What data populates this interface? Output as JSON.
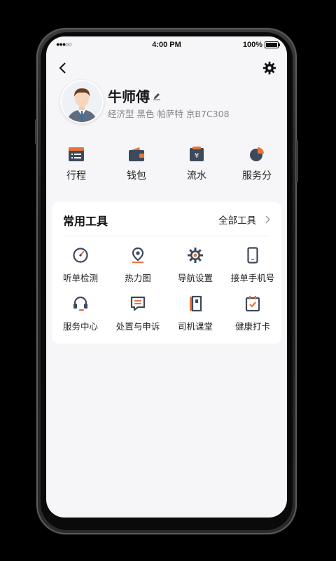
{
  "status_bar": {
    "signal": "●●●○○",
    "time": "4:00 PM",
    "battery": "100%"
  },
  "header": {
    "back_icon": "chevron-left-icon",
    "settings_icon": "gear-icon"
  },
  "profile": {
    "name": "牛师傅",
    "car_info": "经济型 黑色 帕萨特 京B7C308"
  },
  "quick_actions": [
    {
      "label": "行程",
      "icon": "trip-list-icon"
    },
    {
      "label": "钱包",
      "icon": "wallet-icon"
    },
    {
      "label": "流水",
      "icon": "income-flow-icon"
    },
    {
      "label": "服务分",
      "icon": "pie-score-icon"
    }
  ],
  "tools": {
    "title": "常用工具",
    "all_label": "全部工具",
    "items": [
      {
        "label": "听单检测",
        "icon": "gauge-icon"
      },
      {
        "label": "热力图",
        "icon": "location-pin-icon"
      },
      {
        "label": "导航设置",
        "icon": "settings-cog-icon"
      },
      {
        "label": "接单手机号",
        "icon": "phone-icon"
      },
      {
        "label": "服务中心",
        "icon": "headset-icon"
      },
      {
        "label": "处置与申诉",
        "icon": "message-list-icon"
      },
      {
        "label": "司机课堂",
        "icon": "book-icon"
      },
      {
        "label": "健康打卡",
        "icon": "calendar-check-icon"
      }
    ]
  },
  "colors": {
    "accent": "#e8743b",
    "dark": "#3c4a5c"
  }
}
